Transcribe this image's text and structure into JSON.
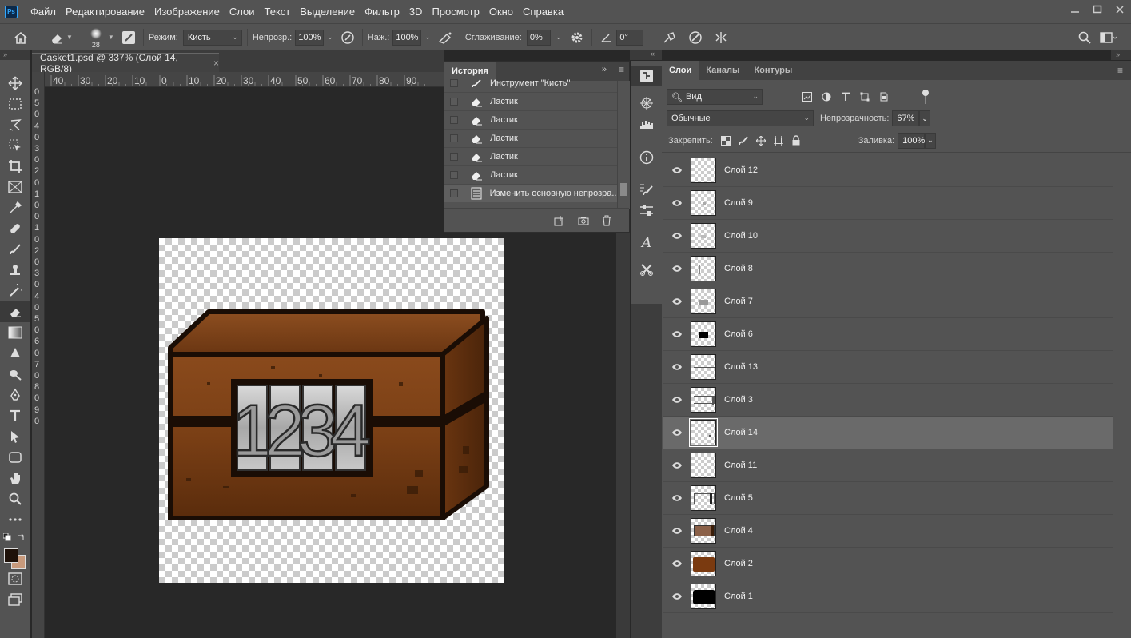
{
  "menu": [
    "Файл",
    "Редактирование",
    "Изображение",
    "Слои",
    "Текст",
    "Выделение",
    "Фильтр",
    "3D",
    "Просмотр",
    "Окно",
    "Справка"
  ],
  "logo": "Ps",
  "options": {
    "brush_size": "28",
    "mode_label": "Режим:",
    "mode_value": "Кисть",
    "opacity_label": "Непрозр.:",
    "opacity_value": "100%",
    "pressure_label": "Наж.:",
    "pressure_value": "100%",
    "smoothing_label": "Сглаживание:",
    "smoothing_value": "0%",
    "angle_value": "0°"
  },
  "document": {
    "tab_title": "Casket1.psd @ 337% (Слой 14, RGB/8)",
    "close": "×",
    "ruler_h": [
      "40",
      "30",
      "20",
      "10",
      "0",
      "10",
      "20",
      "30",
      "40",
      "50",
      "60",
      "70",
      "80",
      "90"
    ],
    "ruler_v": [
      "0",
      "5",
      "0",
      "4",
      "0",
      "3",
      "0",
      "2",
      "0",
      "1",
      "0",
      "0",
      "1",
      "0",
      "2",
      "0",
      "3",
      "0",
      "4",
      "0",
      "5",
      "0",
      "6",
      "0",
      "7",
      "0",
      "8",
      "0",
      "9",
      "0"
    ]
  },
  "history": {
    "title": "История",
    "items": [
      {
        "label": "Инструмент \"Кисть\"",
        "icon": "brush-icon"
      },
      {
        "label": "Ластик",
        "icon": "eraser-icon"
      },
      {
        "label": "Ластик",
        "icon": "eraser-icon"
      },
      {
        "label": "Ластик",
        "icon": "eraser-icon"
      },
      {
        "label": "Ластик",
        "icon": "eraser-icon"
      },
      {
        "label": "Ластик",
        "icon": "eraser-icon"
      },
      {
        "label": "Изменить основную непрозра...",
        "icon": "document-icon"
      }
    ]
  },
  "layers_panel": {
    "tabs": [
      "Слои",
      "Каналы",
      "Контуры"
    ],
    "filter_label": "Вид",
    "blend_mode": "Обычные",
    "opacity_label": "Непрозрачность:",
    "opacity_value": "67%",
    "lock_label": "Закрепить:",
    "fill_label": "Заливка:",
    "fill_value": "100%",
    "layers": [
      {
        "name": "Слой 12",
        "selected": false
      },
      {
        "name": "Слой 9",
        "selected": false
      },
      {
        "name": "Слой 10",
        "selected": false
      },
      {
        "name": "Слой 8",
        "selected": false
      },
      {
        "name": "Слой 7",
        "selected": false
      },
      {
        "name": "Слой 6",
        "selected": false
      },
      {
        "name": "Слой 13",
        "selected": false
      },
      {
        "name": "Слой 3",
        "selected": false
      },
      {
        "name": "Слой 14",
        "selected": true
      },
      {
        "name": "Слой 11",
        "selected": false
      },
      {
        "name": "Слой 5",
        "selected": false
      },
      {
        "name": "Слой 4",
        "selected": false
      },
      {
        "name": "Слой 2",
        "selected": false
      },
      {
        "name": "Слой 1",
        "selected": false
      }
    ]
  },
  "canvas_art": {
    "digits": [
      "1",
      "2",
      "3",
      "4"
    ]
  },
  "colors": {
    "foreground": "#1e1109",
    "background": "#c89a7c",
    "ui_bg": "#535353"
  }
}
